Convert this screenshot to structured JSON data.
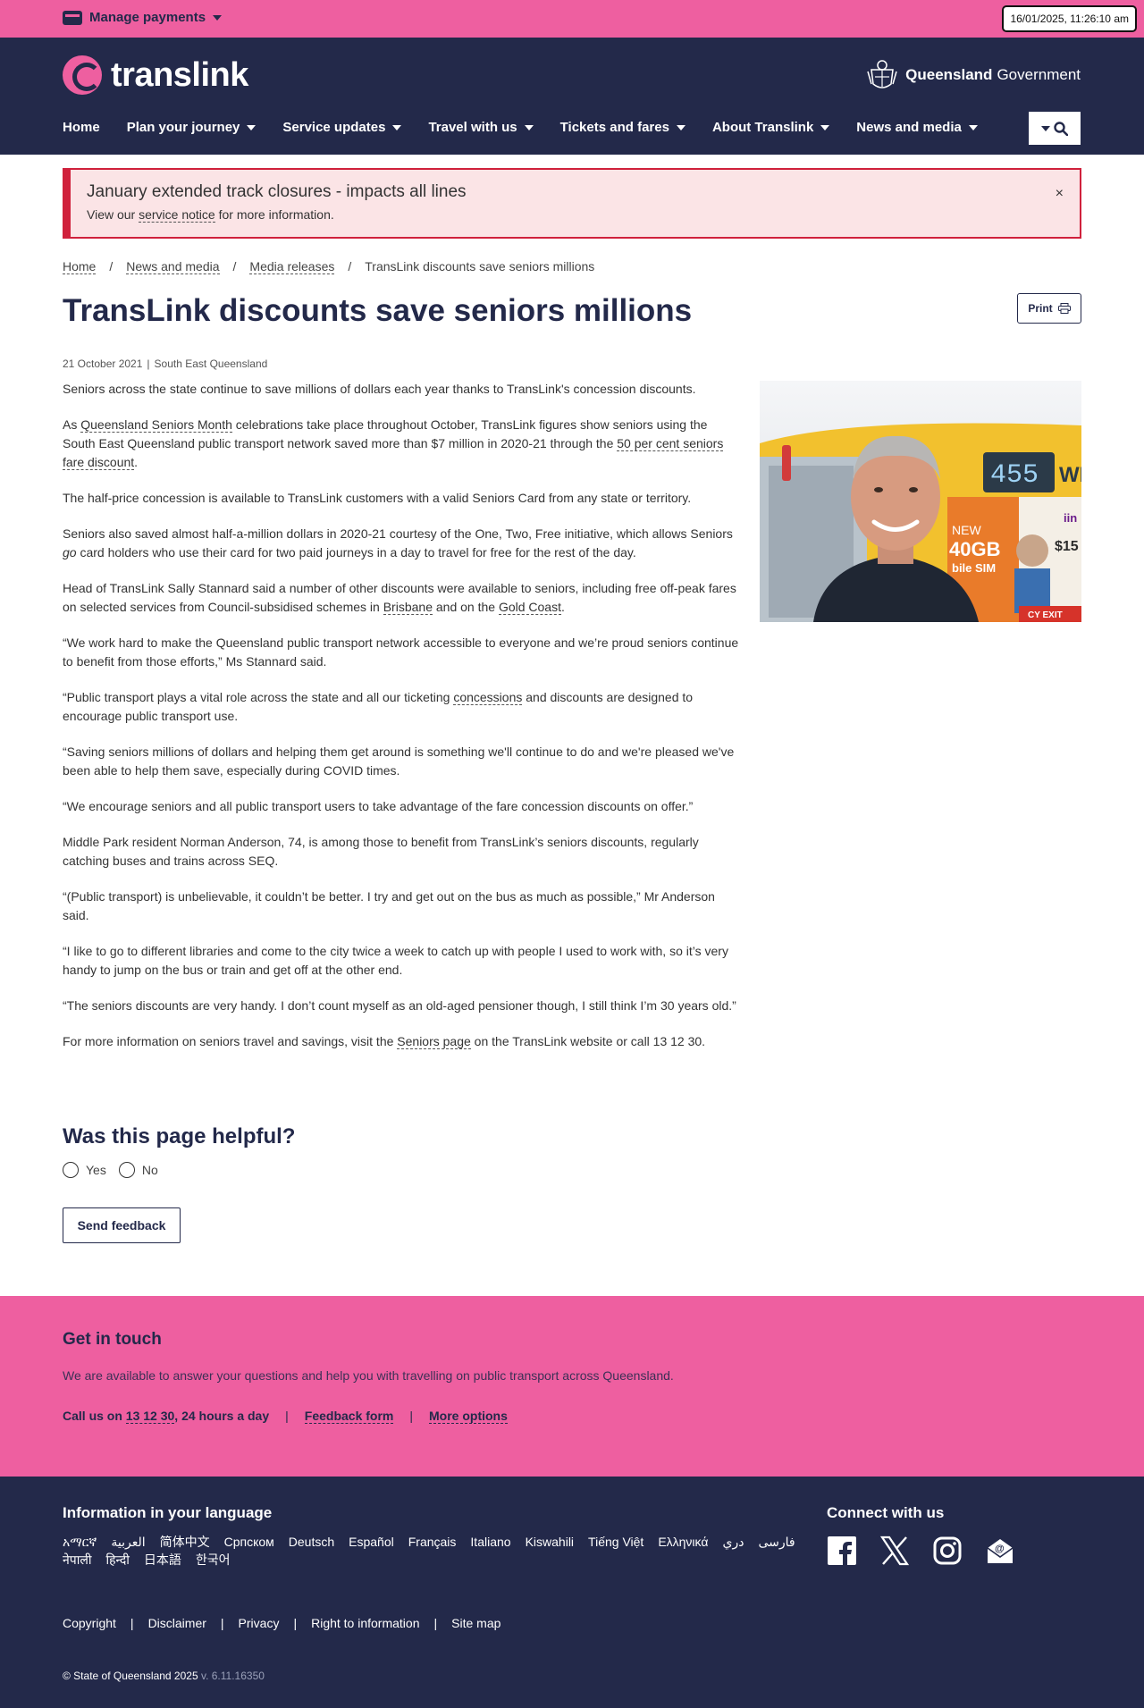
{
  "topbar": {
    "manage_payments": "Manage payments",
    "datetime": "16/01/2025, 11:26:10 am"
  },
  "header": {
    "logo_text": "translink",
    "gov_bold": "Queensland",
    "gov_rest": "Government",
    "nav": [
      "Home",
      "Plan your journey",
      "Service updates",
      "Travel with us",
      "Tickets and fares",
      "About Translink",
      "News and media"
    ]
  },
  "alert": {
    "title": "January extended track closures - impacts all lines",
    "body_pre": "View our ",
    "body_link": "service notice",
    "body_post": " for more information.",
    "close": "×"
  },
  "breadcrumb": [
    "Home",
    "News and media",
    "Media releases",
    "TransLink discounts save seniors millions"
  ],
  "page": {
    "title": "TransLink discounts save seniors millions",
    "print_label": "Print",
    "date": "21 October 2021",
    "region": "South East Queensland"
  },
  "article": {
    "p1": "Seniors across the state continue to save millions of dollars each year thanks to TransLink's concession discounts.",
    "p2_a": "As ",
    "p2_link1": "Queensland Seniors Month",
    "p2_b": " celebrations take place throughout October, TransLink figures show seniors using the South East Queensland public transport network saved more than $7 million in 2020-21 through the ",
    "p2_link2": "50 per cent seniors fare discount",
    "p2_c": ".",
    "p3": "The half-price concession is available to TransLink customers with a valid Seniors Card from any state or territory.",
    "p4_a": "Seniors also saved almost half-a-million dollars in 2020-21 courtesy of the One, Two, Free initiative, which allows Seniors ",
    "p4_em": "go",
    "p4_b": " card holders who use their card for two paid journeys in a day to travel for free for the rest of the day.",
    "p5_a": "Head of TransLink Sally Stannard said a number of other discounts were available to seniors, including free off-peak fares on selected services from Council-subsidised schemes in ",
    "p5_link1": "Brisbane",
    "p5_b": " and on the ",
    "p5_link2": "Gold Coast",
    "p5_c": ".",
    "p6": "“We work hard to make the Queensland public transport network accessible to everyone and we’re proud seniors continue to benefit from those efforts,” Ms Stannard said.",
    "p7_a": "“Public transport plays a vital role across the state and all our ticketing ",
    "p7_link": "concessions",
    "p7_b": " and discounts are designed to encourage public transport use.",
    "p8": "“Saving seniors millions of dollars and helping them get around is something we'll continue to do and we're pleased we've been able to help them save, especially during COVID times.",
    "p9": "“We encourage seniors and all public transport users to take advantage of the fare concession discounts on offer.”",
    "p10": "Middle Park resident Norman Anderson, 74, is among those to benefit from TransLink’s seniors discounts, regularly catching buses and trains across SEQ.",
    "p11": "“(Public transport) is unbelievable, it couldn’t be better. I try and get out on the bus as much as possible,” Mr Anderson said.",
    "p12": "“I like to go to different libraries and come to the city twice a week to catch up with people I used to work with, so it’s very handy to jump on the bus or train and get off at the other end.",
    "p13": "“The seniors discounts are very handy. I don’t count myself as an old-aged pensioner though, I still think I’m 30 years old.”",
    "p14_a": "For more information on seniors travel and savings, visit the ",
    "p14_link": "Seniors page",
    "p14_b": " on the TransLink website or call 13 12 30."
  },
  "photo": {
    "sign": "455",
    "ad_new": "NEW",
    "ad_big": "40GB",
    "ad_sub": "bile SIM",
    "price": "$15",
    "exit": "CY EXIT",
    "side": "WI",
    "brand": "iin"
  },
  "feedback": {
    "title": "Was this page helpful?",
    "yes": "Yes",
    "no": "No",
    "send": "Send feedback"
  },
  "touch": {
    "title": "Get in touch",
    "desc": "We are available to answer your questions and help you with travelling on public transport across Queensland.",
    "call_pre": "Call us on ",
    "call_num": "13 12 30",
    "call_post": ", 24 hours a day",
    "feedback_form": "Feedback form",
    "more_options": "More options",
    "sep": "|"
  },
  "footer": {
    "lang_title": "Information in your language",
    "languages": [
      "አማርኛ",
      "العربية",
      "简体中文",
      "Српском",
      "Deutsch",
      "Español",
      "Français",
      "Italiano",
      "Kiswahili",
      "Tiếng Việt",
      "Ελληνικά",
      "دري",
      "فارسی",
      "नेपाली",
      "हिन्दी",
      "日本語",
      "한국어"
    ],
    "connect_title": "Connect with us",
    "links": [
      "Copyright",
      "Disclaimer",
      "Privacy",
      "Right to information",
      "Site map"
    ],
    "copyright": "© State of Queensland 2025",
    "version": "v. 6.11.16350"
  },
  "colors": {
    "brand_pink": "#ee5fa0",
    "brand_navy": "#23294a",
    "alert_red": "#d0213c"
  }
}
